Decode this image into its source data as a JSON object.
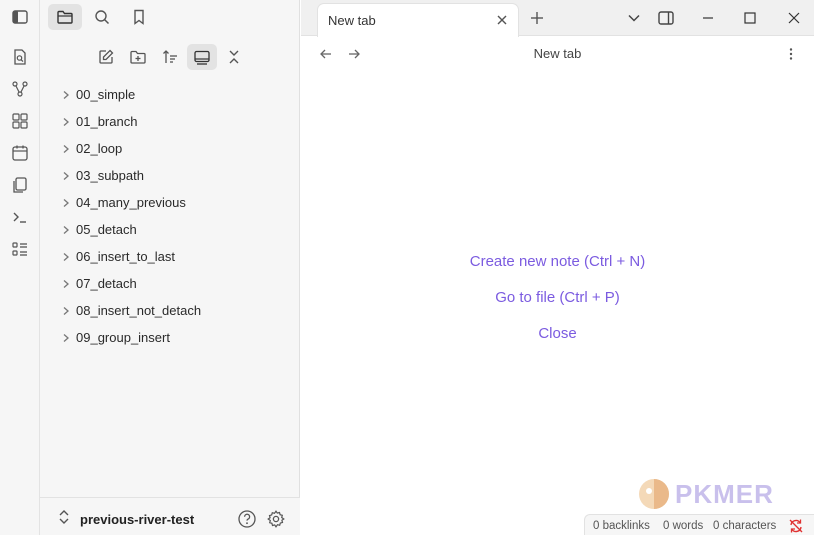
{
  "sidebar": {
    "top_buttons": [
      {
        "icon": "folder-icon",
        "active": true
      },
      {
        "icon": "search-icon",
        "active": false
      },
      {
        "icon": "bookmark-icon",
        "active": false
      }
    ],
    "actions": [
      {
        "icon": "new-note-icon"
      },
      {
        "icon": "new-folder-icon"
      },
      {
        "icon": "sort-icon"
      },
      {
        "icon": "auto-reveal-icon",
        "active": true
      },
      {
        "icon": "collapse-all-icon"
      }
    ],
    "folders": [
      "00_simple",
      "01_branch",
      "02_loop",
      "03_subpath",
      "04_many_previous",
      "05_detach",
      "06_insert_to_last",
      "07_detach",
      "08_insert_not_detach",
      "09_group_insert"
    ],
    "vault_name": "previous-river-test"
  },
  "ribbon": {
    "icons": [
      "sidebar-toggle-icon",
      "quick-switcher-icon",
      "graph-icon",
      "canvas-icon",
      "daily-note-icon",
      "templates-icon",
      "command-palette-icon",
      "outline-icon"
    ]
  },
  "tabs": [
    {
      "title": "New tab",
      "active": true
    }
  ],
  "view": {
    "title": "New tab",
    "actions": {
      "create": "Create new note (Ctrl + N)",
      "goto": "Go to file (Ctrl + P)",
      "close": "Close"
    }
  },
  "watermark": {
    "text": "PKMER"
  },
  "status": {
    "backlinks": "0 backlinks",
    "words": "0 words",
    "characters": "0 characters"
  },
  "colors": {
    "accent": "#7b5be0",
    "sync_error": "#e03131"
  }
}
